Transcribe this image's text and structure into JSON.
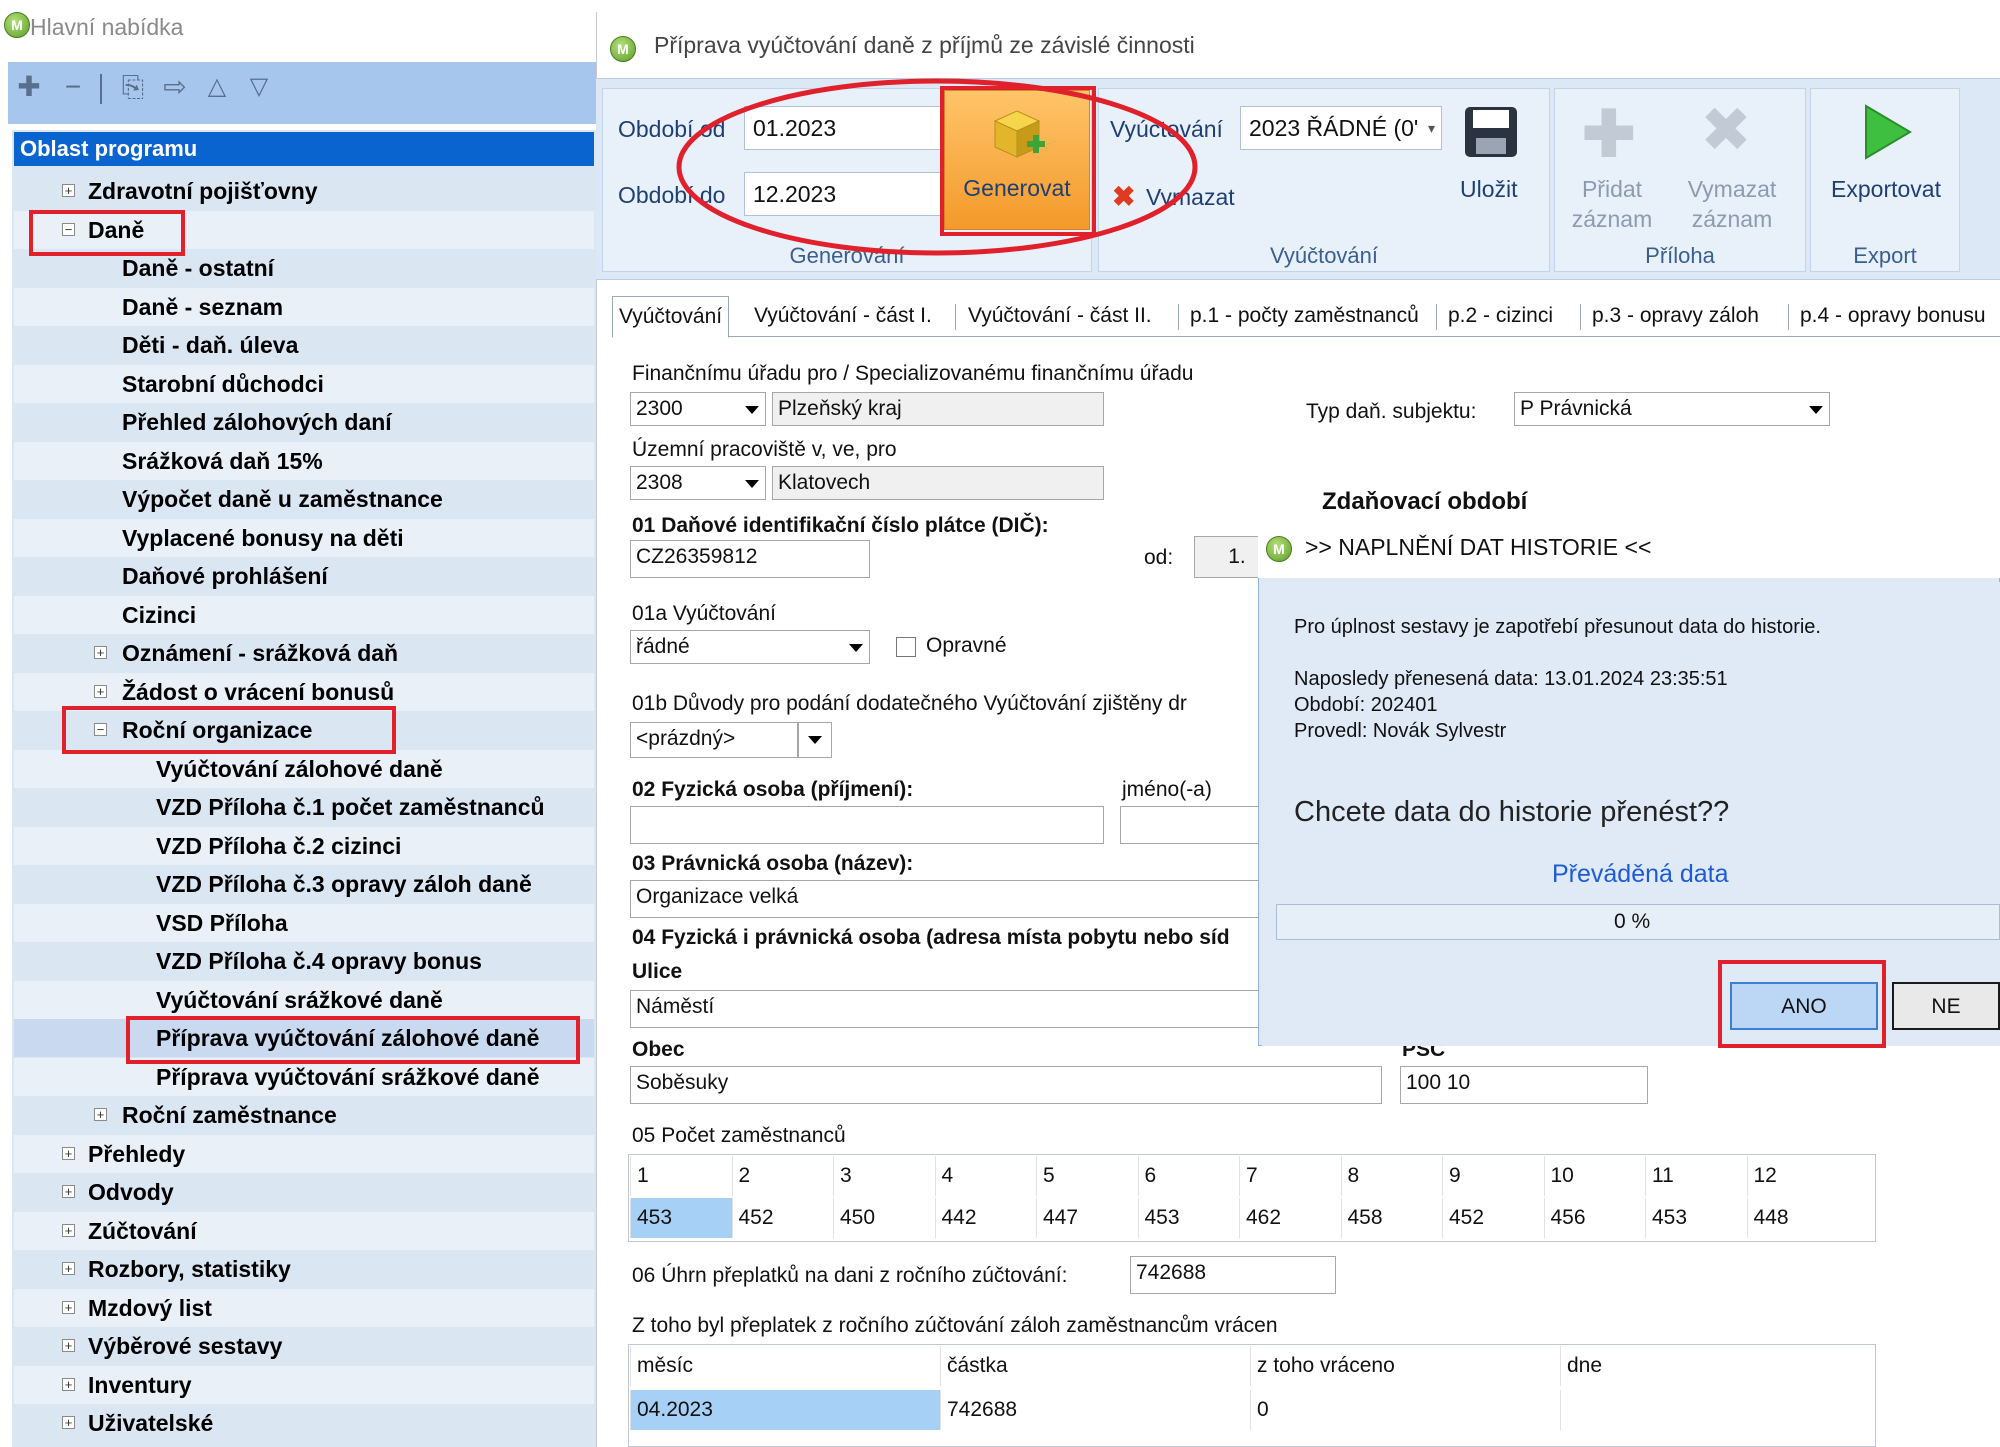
{
  "left_panel": {
    "title": "Hlavní nabídka",
    "tree_header": "Oblast programu",
    "items": [
      {
        "label": "Zdravotní pojišťovny",
        "expander": "+"
      },
      {
        "label": "Daně",
        "expander": "−"
      },
      {
        "label": "Daně - ostatní"
      },
      {
        "label": "Daně - seznam"
      },
      {
        "label": "Děti - daň. úleva"
      },
      {
        "label": "Starobní důchodci"
      },
      {
        "label": "Přehled zálohových daní"
      },
      {
        "label": "Srážková daň 15%"
      },
      {
        "label": "Výpočet daně u zaměstnance"
      },
      {
        "label": "Vyplacené bonusy na děti"
      },
      {
        "label": "Daňové prohlášení"
      },
      {
        "label": "Cizinci"
      },
      {
        "label": "Oznámení - srážková daň",
        "expander": "+"
      },
      {
        "label": "Žádost o vrácení bonusů",
        "expander": "+"
      },
      {
        "label": "Roční organizace",
        "expander": "−"
      },
      {
        "label": "Vyúčtování zálohové daně"
      },
      {
        "label": "VZD Příloha č.1 počet zaměstnanců"
      },
      {
        "label": "VZD Příloha č.2 cizinci"
      },
      {
        "label": "VZD Příloha č.3 opravy záloh daně"
      },
      {
        "label": "VSD Příloha"
      },
      {
        "label": "VZD Příloha č.4 opravy bonus"
      },
      {
        "label": "Vyúčtování srážkové daně"
      },
      {
        "label": "Příprava vyúčtování zálohové daně"
      },
      {
        "label": "Příprava vyúčtování srážkové daně"
      },
      {
        "label": "Roční zaměstnance",
        "expander": "+"
      },
      {
        "label": "Přehledy",
        "expander": "+"
      },
      {
        "label": "Odvody",
        "expander": "+"
      },
      {
        "label": "Zúčtování",
        "expander": "+"
      },
      {
        "label": "Rozbory, statistiky",
        "expander": "+"
      },
      {
        "label": "Mzdový list",
        "expander": "+"
      },
      {
        "label": "Výběrové sestavy",
        "expander": "+"
      },
      {
        "label": "Inventury",
        "expander": "+"
      },
      {
        "label": "Uživatelské",
        "expander": "+"
      }
    ]
  },
  "main": {
    "title": "Příprava vyúčtování daně z příjmů ze závislé činnosti",
    "ribbon": {
      "obdobi_od_label": "Období od",
      "obdobi_od_value": "01.2023",
      "obdobi_do_label": "Období do",
      "obdobi_do_value": "12.2023",
      "generovat_label": "Generovat",
      "group_generovani": "Generování",
      "vyuctovani_label": "Vyúčtování",
      "vyuctovani_value": "2023 ŘÁDNÉ (0'",
      "vymazat_label": "Vymazat",
      "ulozit_label": "Uložit",
      "group_vyuctovani": "Vyúčtování",
      "pridat_label_1": "Přidat",
      "pridat_label_2": "záznam",
      "vymazat_zaznam_1": "Vymazat",
      "vymazat_zaznam_2": "záznam",
      "group_priloha": "Příloha",
      "exportovat_label": "Exportovat",
      "group_export": "Export"
    },
    "tabs": [
      "Vyúčtování",
      "Vyúčtování - část I.",
      "Vyúčtování - část II.",
      "p.1 - počty zaměstnanců",
      "p.2 - cizinci",
      "p.3 - opravy záloh",
      "p.4 - opravy bonusu"
    ],
    "form": {
      "fu_label": "Finančnímu úřadu pro / Specializovanému finančnímu úřadu",
      "fu_code": "2300",
      "fu_name": "Plzeňský kraj",
      "typ_label": "Typ daň. subjektu:",
      "typ_value": "P Právnická",
      "uzemni_label": "Územní pracoviště v, ve, pro",
      "uzemni_code": "2308",
      "uzemni_name": "Klatovech",
      "zdanovaci_label": "Zdaňovací období",
      "dic_label": "01 Daňové identifikační číslo plátce (DIČ):",
      "dic_value": "CZ26359812",
      "od_label": "od:",
      "od_value": "1.",
      "vyuctovani_01a_label": "01a Vyúčtování",
      "vyuctovani_01a_value": "řádné",
      "opravne_label": "Opravné",
      "duvody_label": "01b Důvody pro podání dodatečného Vyúčtování zjištěny dr",
      "duvody_value": "<prázdný>",
      "fo_label": "02 Fyzická osoba (příjmení):",
      "jmeno_label": "jméno(-a)",
      "po_label": "03 Právnická osoba (název):",
      "po_value": "Organizace velká",
      "adresa_label": "04 Fyzická i právnická osoba (adresa místa pobytu nebo síd",
      "ulice_label": "Ulice",
      "ulice_value": "Náměstí",
      "obec_label": "Obec",
      "psc_label": "PSČ",
      "obec_value": "Soběsuky",
      "psc_value": "100 10",
      "pocet_label": "05 Počet zaměstnanců",
      "pocet_headers": [
        "1",
        "2",
        "3",
        "4",
        "5",
        "6",
        "7",
        "8",
        "9",
        "10",
        "11",
        "12"
      ],
      "pocet_values": [
        "453",
        "452",
        "450",
        "442",
        "447",
        "453",
        "462",
        "458",
        "452",
        "456",
        "453",
        "448"
      ],
      "uhrn_label": "06 Úhrn přeplatků na dani z ročního zúčtování:",
      "uhrn_value": "742688",
      "ztoho_label": "Z toho byl přeplatek z ročního zúčtování záloh zaměstnancům vrácen",
      "ztoho_headers": [
        "měsíc",
        "částka",
        "z toho vráceno",
        "dne"
      ],
      "ztoho_row": [
        "04.2023",
        "742688",
        "0",
        ""
      ]
    }
  },
  "dialog": {
    "title": ">> NAPLNĚNÍ DAT HISTORIE <<",
    "line1": "Pro úplnost sestavy je zapotřebí přesunout data do historie.",
    "line2": "Naposledy přenesená data: 13.01.2024 23:35:51",
    "line3": "Období: 202401",
    "line4": "Provedl: Novák Sylvestr",
    "question": "Chcete data do historie přenést??",
    "progress_label": "Převáděná data",
    "progress_text": "0 %",
    "progress": 0,
    "ano_label": "ANO",
    "ne_label": "NE"
  },
  "colors": {
    "highlight_red": "#e0202a",
    "tree_header_blue": "#0a64d0",
    "ribbon_bg": "#dde8f6"
  }
}
